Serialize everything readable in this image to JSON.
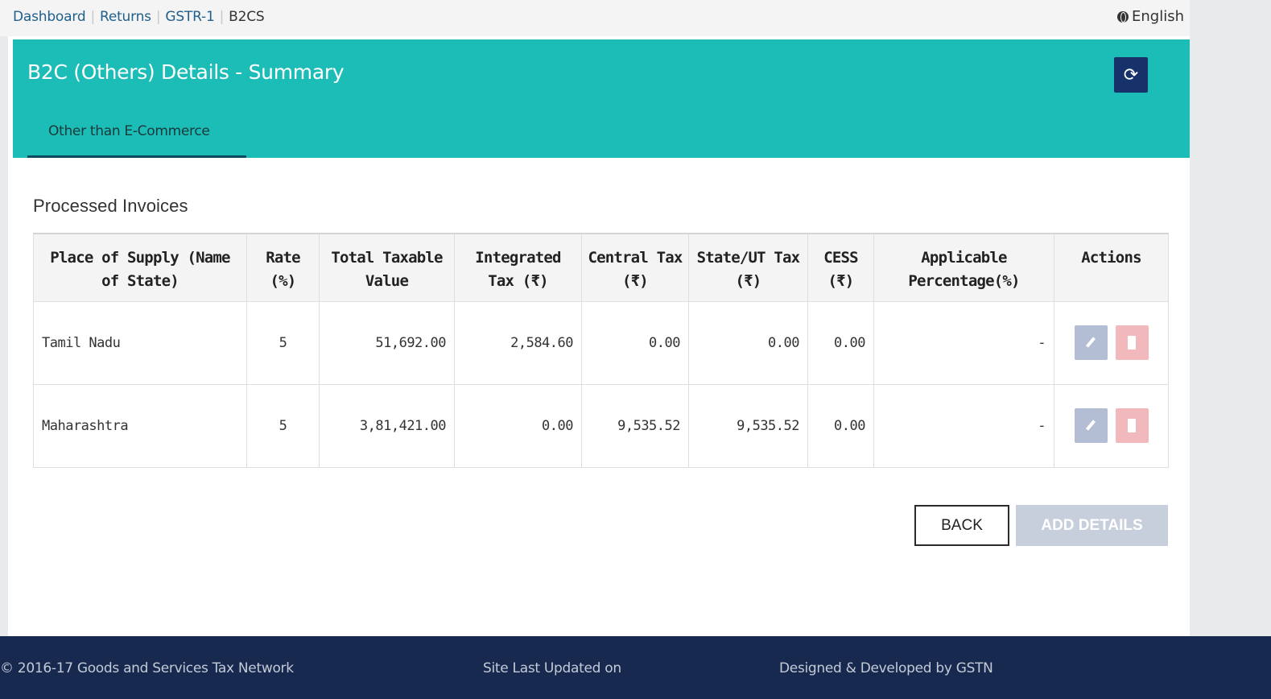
{
  "breadcrumb": {
    "items": [
      "Dashboard",
      "Returns",
      "GSTR-1"
    ],
    "current": "B2CS",
    "separator": "|"
  },
  "language": "English",
  "header": {
    "title": "B2C (Others) Details - Summary",
    "tab": "Other than E-Commerce",
    "refresh_icon": "refresh-icon"
  },
  "section_title": "Processed Invoices",
  "table": {
    "columns": [
      "Place of Supply (Name of State)",
      "Rate (%)",
      "Total Taxable Value",
      "Integrated Tax (₹)",
      "Central Tax (₹)",
      "State/UT Tax (₹)",
      "CESS (₹)",
      "Applicable Percentage(%)",
      "Actions"
    ],
    "rows": [
      {
        "place": "Tamil Nadu",
        "rate": "5",
        "taxable": "51,692.00",
        "igst": "2,584.60",
        "cgst": "0.00",
        "sgst": "0.00",
        "cess": "0.00",
        "applicable": "-"
      },
      {
        "place": "Maharashtra",
        "rate": "5",
        "taxable": "3,81,421.00",
        "igst": "0.00",
        "cgst": "9,535.52",
        "sgst": "9,535.52",
        "cess": "0.00",
        "applicable": "-"
      }
    ]
  },
  "buttons": {
    "back": "BACK",
    "add": "ADD DETAILS"
  },
  "footer": {
    "copyright": "© 2016-17 Goods and Services Tax Network",
    "updated": "Site Last Updated on",
    "designed": "Designed & Developed by GSTN"
  },
  "colors": {
    "header_teal": "#1cbcb7",
    "footer_navy": "#17294f",
    "refresh_button": "#17326a",
    "edit_button": "#b3bdd3",
    "delete_button": "#f1b9bc"
  }
}
